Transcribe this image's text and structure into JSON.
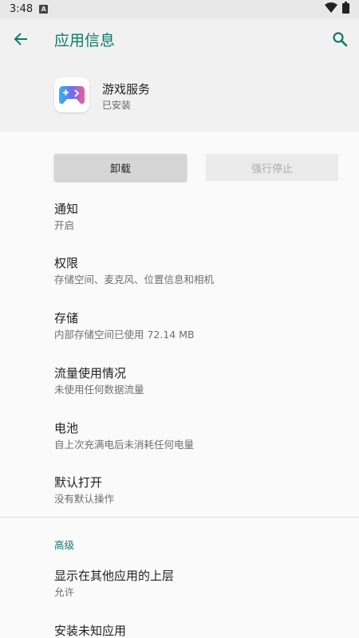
{
  "status_bar": {
    "time": "3:48",
    "notification_icon": "a-notification-icon",
    "wifi_icon": "wifi-icon",
    "battery_icon": "battery-icon"
  },
  "toolbar": {
    "title": "应用信息",
    "back_icon": "arrow-left-icon",
    "search_icon": "search-icon"
  },
  "app": {
    "name": "游戏服务",
    "status": "已安装",
    "icon": "gamepad-icon"
  },
  "buttons": {
    "uninstall": "卸载",
    "force_stop": "强行停止"
  },
  "prefs": [
    {
      "title": "通知",
      "summary": "开启"
    },
    {
      "title": "权限",
      "summary": "存储空间、麦克风、位置信息和相机"
    },
    {
      "title": "存储",
      "summary": "内部存储空间已使用 72.14 MB"
    },
    {
      "title": "流量使用情况",
      "summary": "未使用任何数据流量"
    },
    {
      "title": "电池",
      "summary": "自上次充满电后未消耗任何电量"
    },
    {
      "title": "默认打开",
      "summary": "没有默认操作"
    }
  ],
  "advanced": {
    "label": "高级",
    "items": [
      {
        "title": "显示在其他应用的上层",
        "summary": "允许"
      },
      {
        "title": "安装未知应用",
        "summary": ""
      }
    ]
  },
  "colors": {
    "accent": "#0b7a6b",
    "header_bg": "#f1f1f1",
    "page_bg": "#fafafa"
  }
}
